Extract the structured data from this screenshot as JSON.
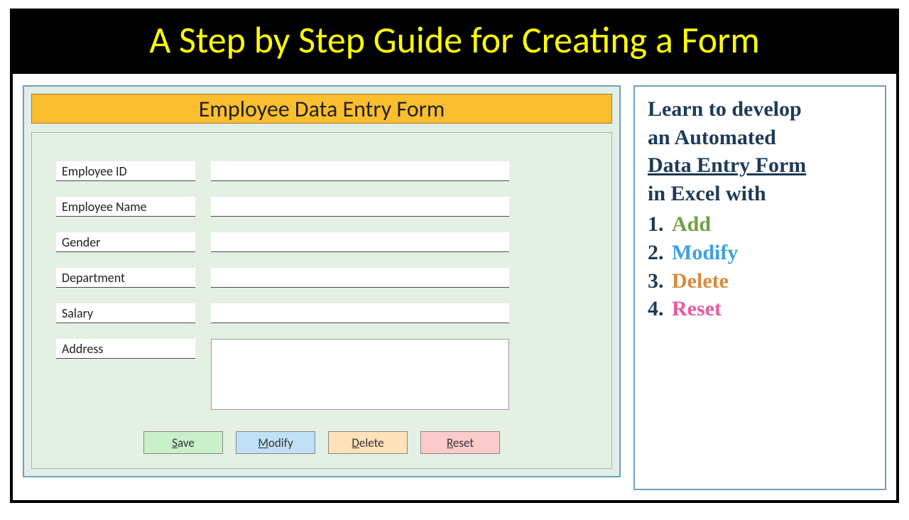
{
  "page_title": "A Step by Step Guide for Creating a Form",
  "form": {
    "header": "Employee Data Entry Form",
    "fields": [
      {
        "label": "Employee ID",
        "value": "",
        "type": "text"
      },
      {
        "label": "Employee Name",
        "value": "",
        "type": "text"
      },
      {
        "label": "Gender",
        "value": "",
        "type": "text"
      },
      {
        "label": "Department",
        "value": "",
        "type": "text"
      },
      {
        "label": "Salary",
        "value": "",
        "type": "text"
      },
      {
        "label": "Address",
        "value": "",
        "type": "textarea"
      }
    ],
    "buttons": {
      "save": {
        "prefix": "S",
        "rest": "ave"
      },
      "modify": {
        "prefix": "M",
        "rest": "odify"
      },
      "delete": {
        "prefix": "D",
        "rest": "elete"
      },
      "reset": {
        "prefix": "R",
        "rest": "eset"
      }
    }
  },
  "info": {
    "line1": "Learn to develop",
    "line2": "an Automated",
    "line3_underlined": "Data Entry Form",
    "line4": "in Excel with",
    "items": [
      {
        "num": "1.",
        "text": "Add",
        "cls": "c-add"
      },
      {
        "num": "2.",
        "text": "Modify",
        "cls": "c-modify"
      },
      {
        "num": "3.",
        "text": "Delete",
        "cls": "c-delete"
      },
      {
        "num": "4.",
        "text": "Reset",
        "cls": "c-reset"
      }
    ]
  }
}
